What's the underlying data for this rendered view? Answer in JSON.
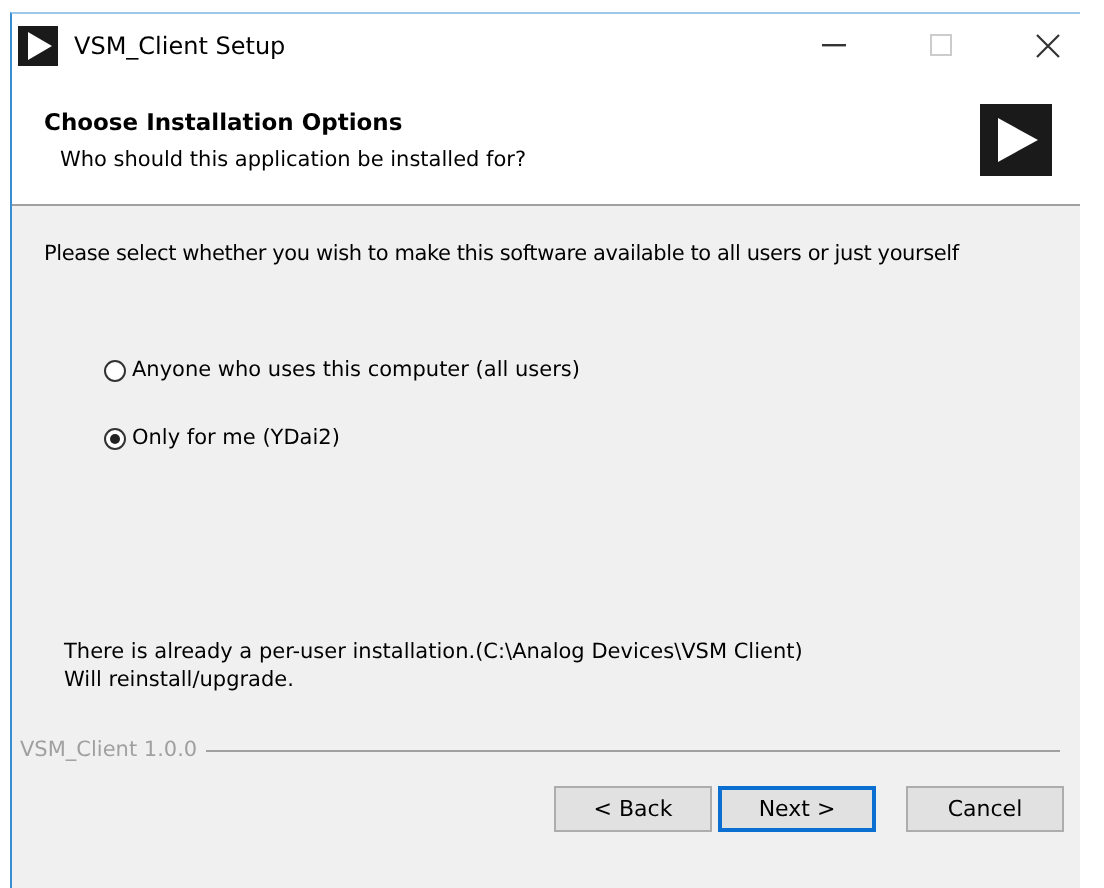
{
  "window": {
    "title": "VSM_Client Setup"
  },
  "header": {
    "title": "Choose Installation Options",
    "subtitle": "Who should this application be installed for?"
  },
  "prompt": "Please select whether you wish to make this software available to all users or just yourself",
  "options": [
    {
      "label": "Anyone who uses this computer (all users)",
      "selected": false
    },
    {
      "label": "Only for me (YDai2)",
      "selected": true
    }
  ],
  "info": [
    "There is already a per-user installation.(C:\\Analog Devices\\VSM Client)",
    "Will reinstall/upgrade."
  ],
  "version": "VSM_Client 1.0.0",
  "buttons": [
    {
      "label": "< Back",
      "default": false
    },
    {
      "label": "Next >",
      "default": true
    },
    {
      "label": "Cancel",
      "default": false
    }
  ]
}
